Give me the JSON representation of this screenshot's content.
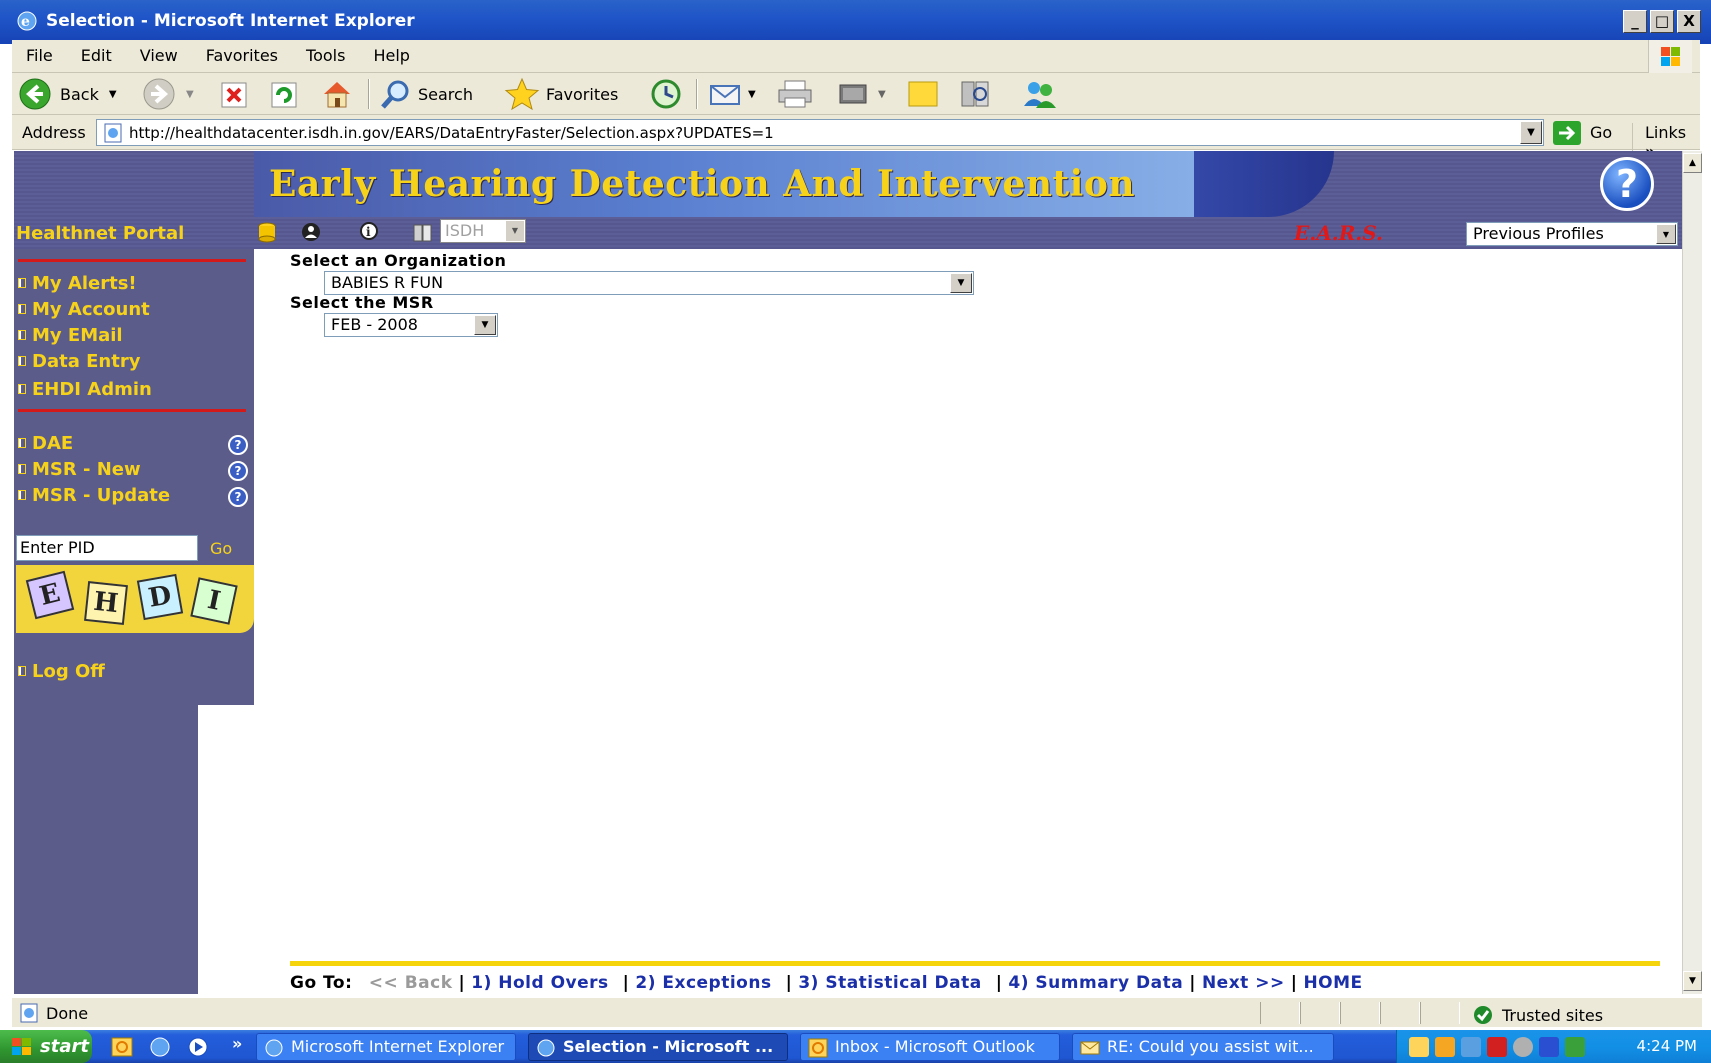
{
  "window": {
    "title": "Selection - Microsoft Internet Explorer",
    "minimize": "_",
    "maximize": "□",
    "close": "X"
  },
  "menu": [
    "File",
    "Edit",
    "View",
    "Favorites",
    "Tools",
    "Help"
  ],
  "toolbar": {
    "back_label": "Back",
    "search_label": "Search",
    "favorites_label": "Favorites"
  },
  "address": {
    "label": "Address",
    "url": "http://healthdatacenter.isdh.in.gov/EARS/DataEntryFaster/Selection.aspx?UPDATES=1",
    "go_label": "Go",
    "links_label": "Links"
  },
  "page": {
    "banner_title": "Early Hearing Detection And Intervention",
    "help_glyph": "?",
    "portal_label": "Healthnet Portal",
    "isdh_value": "ISDH",
    "ears_label": "E.A.R.S.",
    "previous_profiles": "Previous Profiles",
    "nav_primary": [
      "My Alerts!",
      "My Account",
      "My EMail",
      "Data Entry",
      "EHDI Admin"
    ],
    "nav_secondary": [
      "DAE",
      "MSR - New",
      "MSR - Update"
    ],
    "pid_value": "Enter PID",
    "pid_go": "Go",
    "logo_letters": [
      "E",
      "H",
      "D",
      "I"
    ],
    "logoff_label": "Log Off",
    "org_label": "Select an Organization",
    "org_value": "BABIES R FUN",
    "msr_label": "Select the MSR",
    "msr_value": "FEB - 2008",
    "goto": {
      "label": "Go To:",
      "back": "<< Back",
      "hold_overs": "1) Hold Overs",
      "exceptions": "2) Exceptions",
      "statistical": "3) Statistical Data",
      "summary": "4) Summary Data",
      "next": "Next >>",
      "home": "HOME",
      "sep": "|"
    }
  },
  "status": {
    "text": "Done",
    "zone": "Trusted sites"
  },
  "taskbar": {
    "start_label": "start",
    "tasks": [
      "Microsoft Internet Explorer",
      "Selection - Microsoft ...",
      "Inbox - Microsoft Outlook",
      "RE: Could you assist wit..."
    ],
    "chevron": "»",
    "clock": "4:24 PM"
  },
  "colors": {
    "accent_gold": "#f7d21a",
    "nav_purple": "#5c5c8a",
    "link_blue": "#1a2fa8",
    "ears_red": "#e01818",
    "divider_red": "#d31919"
  }
}
